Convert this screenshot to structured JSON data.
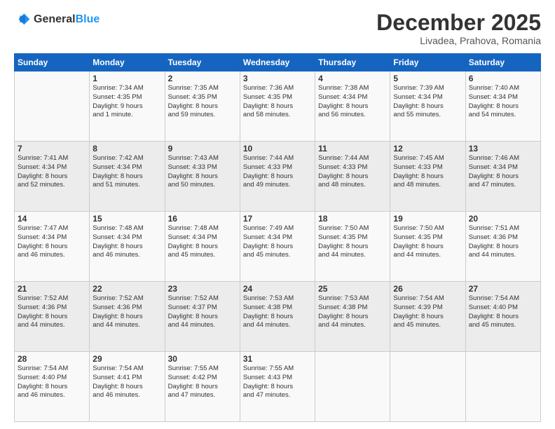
{
  "header": {
    "logo_general": "General",
    "logo_blue": "Blue",
    "month_title": "December 2025",
    "subtitle": "Livadea, Prahova, Romania"
  },
  "days_of_week": [
    "Sunday",
    "Monday",
    "Tuesday",
    "Wednesday",
    "Thursday",
    "Friday",
    "Saturday"
  ],
  "weeks": [
    [
      {
        "day": "",
        "info": ""
      },
      {
        "day": "1",
        "info": "Sunrise: 7:34 AM\nSunset: 4:35 PM\nDaylight: 9 hours\nand 1 minute."
      },
      {
        "day": "2",
        "info": "Sunrise: 7:35 AM\nSunset: 4:35 PM\nDaylight: 8 hours\nand 59 minutes."
      },
      {
        "day": "3",
        "info": "Sunrise: 7:36 AM\nSunset: 4:35 PM\nDaylight: 8 hours\nand 58 minutes."
      },
      {
        "day": "4",
        "info": "Sunrise: 7:38 AM\nSunset: 4:34 PM\nDaylight: 8 hours\nand 56 minutes."
      },
      {
        "day": "5",
        "info": "Sunrise: 7:39 AM\nSunset: 4:34 PM\nDaylight: 8 hours\nand 55 minutes."
      },
      {
        "day": "6",
        "info": "Sunrise: 7:40 AM\nSunset: 4:34 PM\nDaylight: 8 hours\nand 54 minutes."
      }
    ],
    [
      {
        "day": "7",
        "info": "Sunrise: 7:41 AM\nSunset: 4:34 PM\nDaylight: 8 hours\nand 52 minutes."
      },
      {
        "day": "8",
        "info": "Sunrise: 7:42 AM\nSunset: 4:34 PM\nDaylight: 8 hours\nand 51 minutes."
      },
      {
        "day": "9",
        "info": "Sunrise: 7:43 AM\nSunset: 4:33 PM\nDaylight: 8 hours\nand 50 minutes."
      },
      {
        "day": "10",
        "info": "Sunrise: 7:44 AM\nSunset: 4:33 PM\nDaylight: 8 hours\nand 49 minutes."
      },
      {
        "day": "11",
        "info": "Sunrise: 7:44 AM\nSunset: 4:33 PM\nDaylight: 8 hours\nand 48 minutes."
      },
      {
        "day": "12",
        "info": "Sunrise: 7:45 AM\nSunset: 4:33 PM\nDaylight: 8 hours\nand 48 minutes."
      },
      {
        "day": "13",
        "info": "Sunrise: 7:46 AM\nSunset: 4:34 PM\nDaylight: 8 hours\nand 47 minutes."
      }
    ],
    [
      {
        "day": "14",
        "info": "Sunrise: 7:47 AM\nSunset: 4:34 PM\nDaylight: 8 hours\nand 46 minutes."
      },
      {
        "day": "15",
        "info": "Sunrise: 7:48 AM\nSunset: 4:34 PM\nDaylight: 8 hours\nand 46 minutes."
      },
      {
        "day": "16",
        "info": "Sunrise: 7:48 AM\nSunset: 4:34 PM\nDaylight: 8 hours\nand 45 minutes."
      },
      {
        "day": "17",
        "info": "Sunrise: 7:49 AM\nSunset: 4:34 PM\nDaylight: 8 hours\nand 45 minutes."
      },
      {
        "day": "18",
        "info": "Sunrise: 7:50 AM\nSunset: 4:35 PM\nDaylight: 8 hours\nand 44 minutes."
      },
      {
        "day": "19",
        "info": "Sunrise: 7:50 AM\nSunset: 4:35 PM\nDaylight: 8 hours\nand 44 minutes."
      },
      {
        "day": "20",
        "info": "Sunrise: 7:51 AM\nSunset: 4:36 PM\nDaylight: 8 hours\nand 44 minutes."
      }
    ],
    [
      {
        "day": "21",
        "info": "Sunrise: 7:52 AM\nSunset: 4:36 PM\nDaylight: 8 hours\nand 44 minutes."
      },
      {
        "day": "22",
        "info": "Sunrise: 7:52 AM\nSunset: 4:36 PM\nDaylight: 8 hours\nand 44 minutes."
      },
      {
        "day": "23",
        "info": "Sunrise: 7:52 AM\nSunset: 4:37 PM\nDaylight: 8 hours\nand 44 minutes."
      },
      {
        "day": "24",
        "info": "Sunrise: 7:53 AM\nSunset: 4:38 PM\nDaylight: 8 hours\nand 44 minutes."
      },
      {
        "day": "25",
        "info": "Sunrise: 7:53 AM\nSunset: 4:38 PM\nDaylight: 8 hours\nand 44 minutes."
      },
      {
        "day": "26",
        "info": "Sunrise: 7:54 AM\nSunset: 4:39 PM\nDaylight: 8 hours\nand 45 minutes."
      },
      {
        "day": "27",
        "info": "Sunrise: 7:54 AM\nSunset: 4:40 PM\nDaylight: 8 hours\nand 45 minutes."
      }
    ],
    [
      {
        "day": "28",
        "info": "Sunrise: 7:54 AM\nSunset: 4:40 PM\nDaylight: 8 hours\nand 46 minutes."
      },
      {
        "day": "29",
        "info": "Sunrise: 7:54 AM\nSunset: 4:41 PM\nDaylight: 8 hours\nand 46 minutes."
      },
      {
        "day": "30",
        "info": "Sunrise: 7:55 AM\nSunset: 4:42 PM\nDaylight: 8 hours\nand 47 minutes."
      },
      {
        "day": "31",
        "info": "Sunrise: 7:55 AM\nSunset: 4:43 PM\nDaylight: 8 hours\nand 47 minutes."
      },
      {
        "day": "",
        "info": ""
      },
      {
        "day": "",
        "info": ""
      },
      {
        "day": "",
        "info": ""
      }
    ]
  ]
}
